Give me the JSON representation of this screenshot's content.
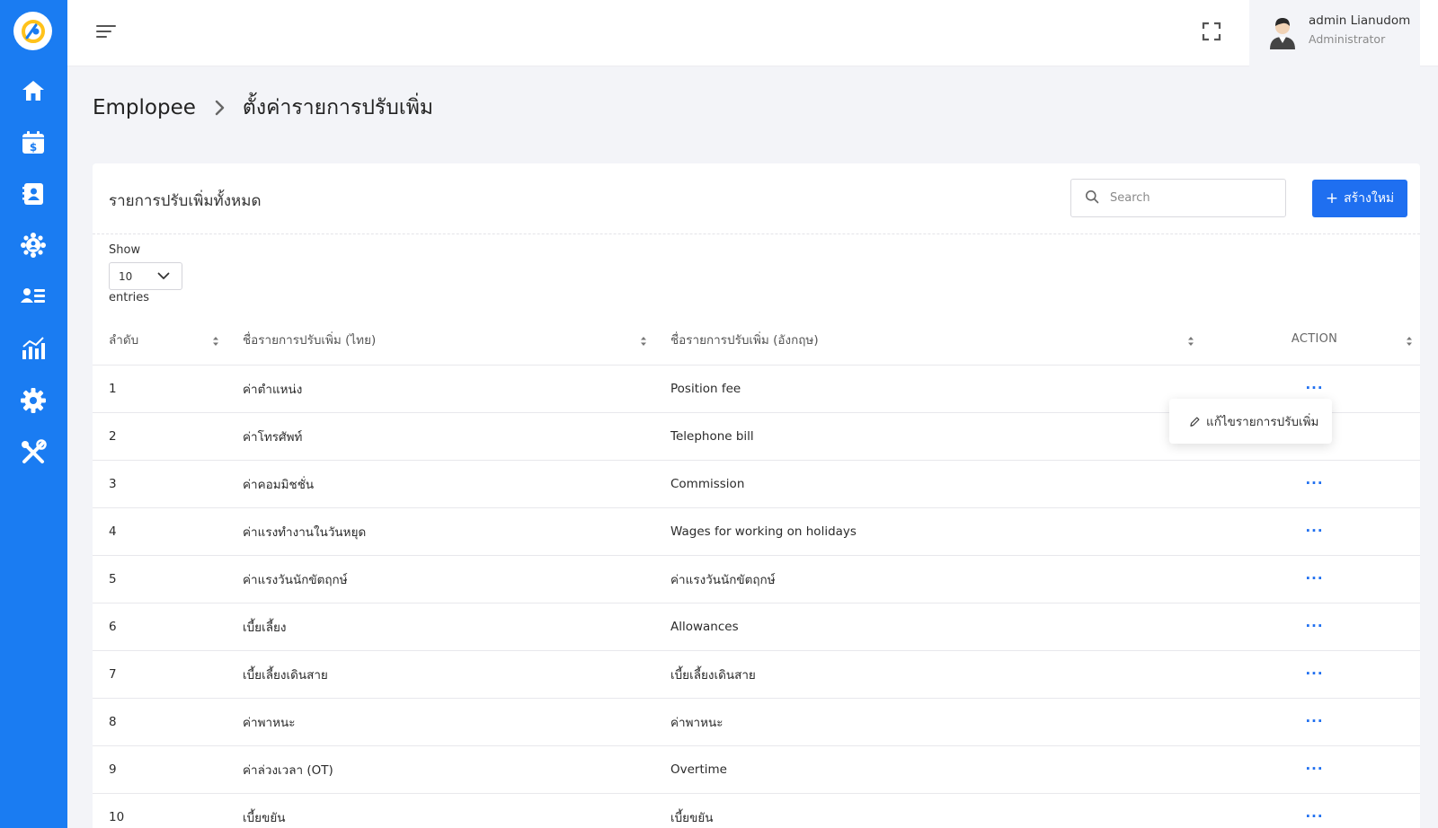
{
  "header": {
    "user": {
      "name": "admin Lianudom",
      "role": "Administrator"
    }
  },
  "sidebar": {
    "icons": [
      "logo-icon",
      "home-icon",
      "payroll-calendar-icon",
      "employee-contact-icon",
      "team-icon",
      "employee-list-icon",
      "report-chart-icon",
      "settings-gear-icon",
      "tools-icon"
    ],
    "accent_color": "#1a7cf2"
  },
  "breadcrumb": {
    "root": "Emplopee",
    "current": "ตั้งค่ารายการปรับเพิ่ม"
  },
  "card": {
    "title": "รายการปรับเพิ่มทั้งหมด",
    "search": {
      "placeholder": "Search",
      "value": ""
    },
    "create_button": {
      "icon": "+",
      "label": "สร้างใหม่"
    },
    "length": {
      "show_label": "Show",
      "value": "10",
      "entries_label": "entries"
    }
  },
  "table": {
    "columns": [
      "ลำดับ",
      "ชื่อรายการปรับเพิ่ม (ไทย)",
      "ชื่อรายการปรับเพิ่ม (อังกฤษ)",
      "ACTION"
    ],
    "rows": [
      {
        "no": "1",
        "name_th": "ค่าตำแหน่ง",
        "name_en": "Position fee"
      },
      {
        "no": "2",
        "name_th": "ค่าโทรศัพท์",
        "name_en": "Telephone bill"
      },
      {
        "no": "3",
        "name_th": "ค่าคอมมิชชั่น",
        "name_en": "Commission"
      },
      {
        "no": "4",
        "name_th": "ค่าแรงทำงานในวันหยุด",
        "name_en": "Wages for working on holidays"
      },
      {
        "no": "5",
        "name_th": "ค่าแรงวันนักขัตฤกษ์",
        "name_en": "ค่าแรงวันนักขัตฤกษ์"
      },
      {
        "no": "6",
        "name_th": "เบี้ยเลี้ยง",
        "name_en": "Allowances"
      },
      {
        "no": "7",
        "name_th": "เบี้ยเลี้ยงเดินสาย",
        "name_en": "เบี้ยเลี้ยงเดินสาย"
      },
      {
        "no": "8",
        "name_th": "ค่าพาหนะ",
        "name_en": "ค่าพาหนะ"
      },
      {
        "no": "9",
        "name_th": "ค่าล่วงเวลา (OT)",
        "name_en": "Overtime"
      },
      {
        "no": "10",
        "name_th": "เบี้ยขยัน",
        "name_en": "เบี้ยขยัน"
      }
    ],
    "action_symbol": "···"
  },
  "dropdown": {
    "edit_label": "แก้ไขรายการปรับเพิ่ม"
  }
}
